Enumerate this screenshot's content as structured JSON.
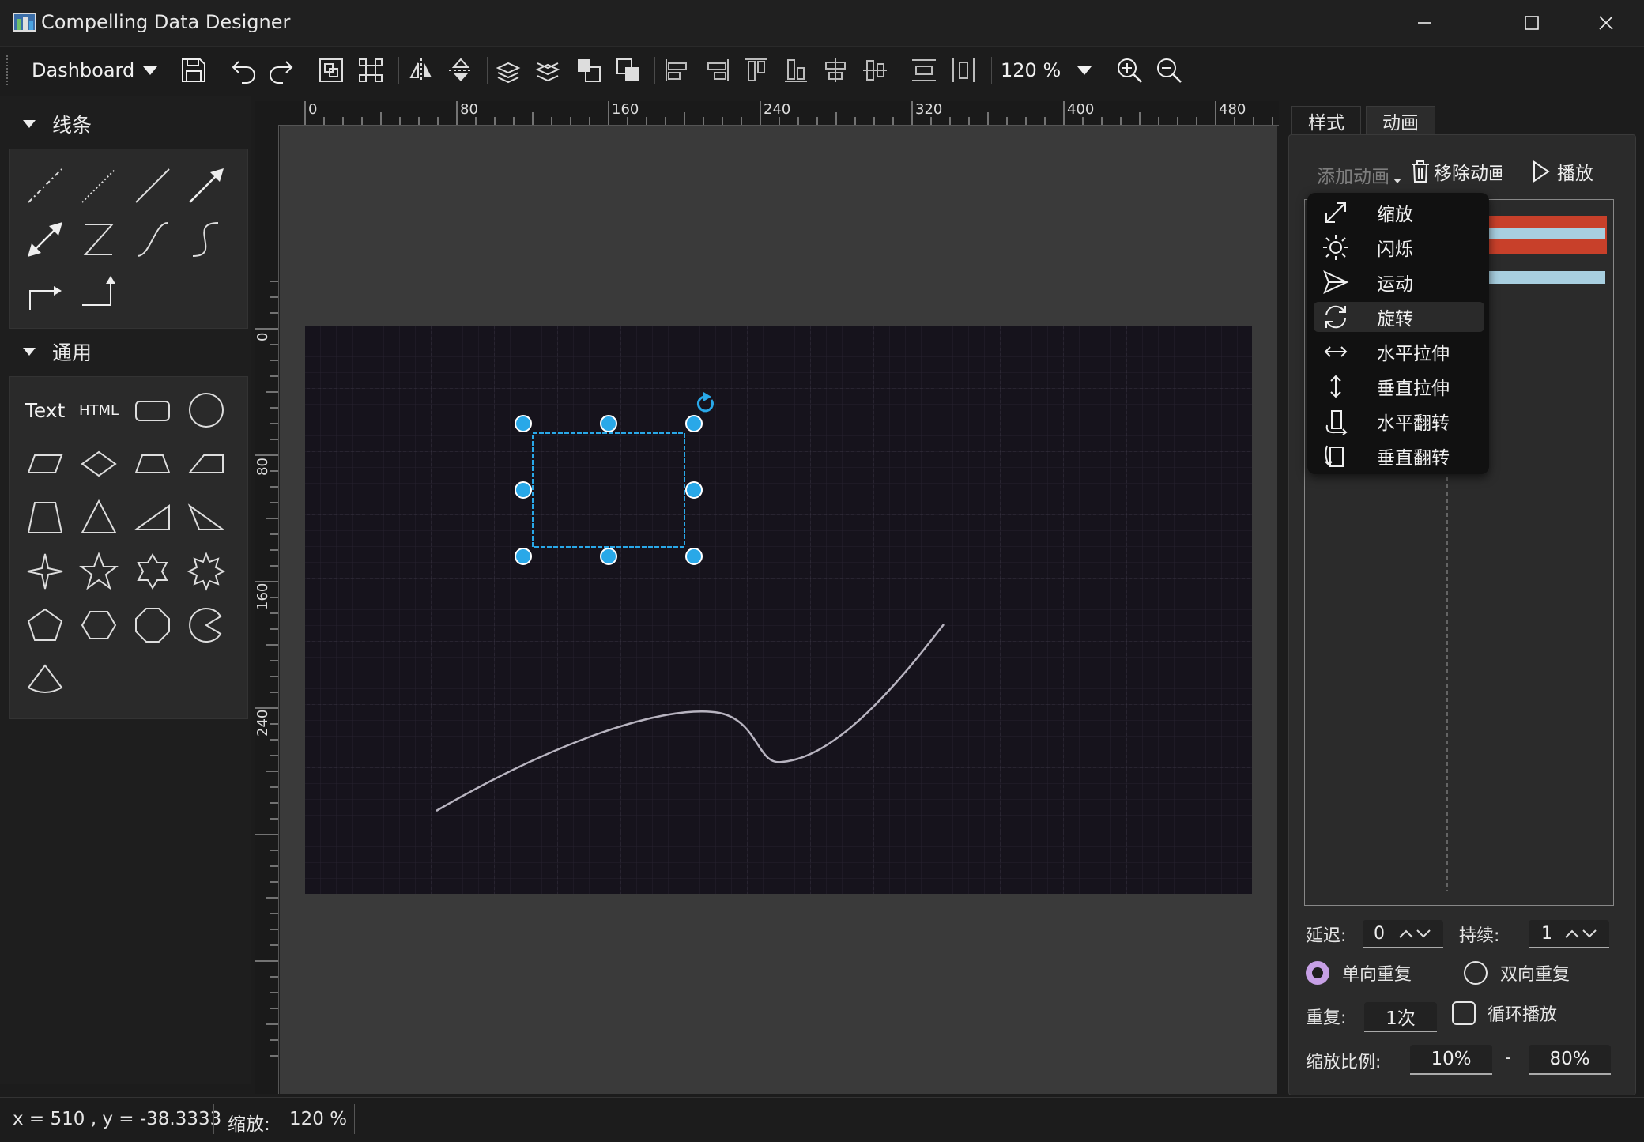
{
  "window": {
    "title": "Compelling Data Designer"
  },
  "toolbar": {
    "dashboard_label": "Dashboard",
    "zoom_value": "120 %"
  },
  "left_panel": {
    "lines_title": "线条",
    "general_title": "通用",
    "text_label": "Text",
    "html_label": "HTML"
  },
  "rulers": {
    "top": [
      "0",
      "80",
      "160",
      "240",
      "320",
      "400",
      "480"
    ],
    "left": [
      "0",
      "80",
      "160",
      "240"
    ]
  },
  "right_panel": {
    "tab_style": "样式",
    "tab_animation": "动画",
    "add_animation": "添加动画",
    "remove_animation": "移除动画",
    "play": "播放",
    "menu_items": [
      "缩放",
      "闪烁",
      "运动",
      "旋转",
      "水平拉伸",
      "垂直拉伸",
      "水平翻转",
      "垂直翻转"
    ],
    "delay_label": "延迟:",
    "delay_value": "0",
    "duration_label": "持续:",
    "duration_value": "1",
    "one_way_repeat": "单向重复",
    "two_way_repeat": "双向重复",
    "repeat_label": "重复:",
    "repeat_value": "1次",
    "loop_label": "循环播放",
    "scale_label": "缩放比例:",
    "scale_from": "10%",
    "scale_dash": "-",
    "scale_to": "80%"
  },
  "status": {
    "coords": "x = 510 , y = -38.3333",
    "zoom_label": "缩放:",
    "zoom_value": "120 %"
  },
  "colors": {
    "accent": "#29a8e8",
    "timeline_red": "#c8402a",
    "timeline_blue": "#a8cfe0",
    "radio_selected": "#c7a0e6"
  }
}
